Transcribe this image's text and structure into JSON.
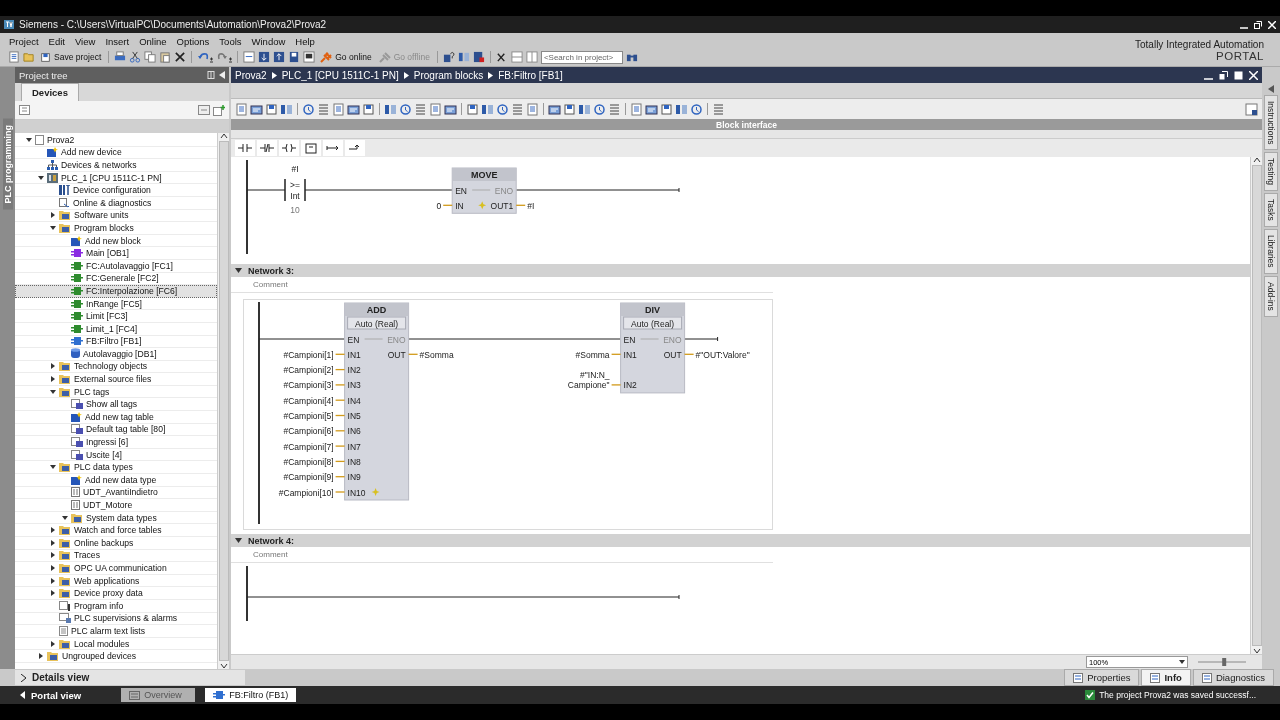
{
  "window": {
    "title": "Siemens  -  C:\\Users\\VirtualPC\\Documents\\Automation\\Prova2\\Prova2"
  },
  "menu": [
    "Project",
    "Edit",
    "View",
    "Insert",
    "Online",
    "Options",
    "Tools",
    "Window",
    "Help"
  ],
  "toolbar": {
    "save": "Save project",
    "go_online": "Go online",
    "go_offline": "Go offline",
    "search": {
      "placeholder": "<Search in project>"
    }
  },
  "brand": {
    "line1": "Totally Integrated Automation",
    "line2": "PORTAL"
  },
  "side_tab": "PLC programming",
  "project_tree": {
    "title": "Project tree",
    "tab": "Devices",
    "details": "Details view",
    "items": [
      {
        "label": "Prova2",
        "kind": "root",
        "expanded": true,
        "selected": false,
        "children": [
          {
            "label": "Add new device",
            "kind": "add",
            "selected": false
          },
          {
            "label": "Devices & networks",
            "kind": "network",
            "selected": false
          },
          {
            "label": "PLC_1 [CPU 1511C-1 PN]",
            "kind": "plc",
            "expanded": true,
            "selected": false,
            "children": [
              {
                "label": "Device configuration",
                "kind": "config",
                "selected": false
              },
              {
                "label": "Online & diagnostics",
                "kind": "diag",
                "selected": false
              },
              {
                "label": "Software units",
                "kind": "folder",
                "expanded": false,
                "selected": false
              },
              {
                "label": "Program blocks",
                "kind": "folder",
                "expanded": true,
                "selected": false,
                "children": [
                  {
                    "label": "Add new block",
                    "kind": "add",
                    "selected": false
                  },
                  {
                    "label": "Main [OB1]",
                    "kind": "ob",
                    "selected": false
                  },
                  {
                    "label": "FC:Autolavaggio [FC1]",
                    "kind": "fc",
                    "selected": false
                  },
                  {
                    "label": "FC:Generale [FC2]",
                    "kind": "fc",
                    "selected": false
                  },
                  {
                    "label": "FC:Interpolazione [FC6]",
                    "kind": "fc",
                    "selected": true
                  },
                  {
                    "label": "InRange [FC5]",
                    "kind": "fc",
                    "selected": false
                  },
                  {
                    "label": "Limit [FC3]",
                    "kind": "fc",
                    "selected": false
                  },
                  {
                    "label": "Limit_1 [FC4]",
                    "kind": "fc",
                    "selected": false
                  },
                  {
                    "label": "FB:Filtro [FB1]",
                    "kind": "fb",
                    "selected": false
                  },
                  {
                    "label": "Autolavaggio [DB1]",
                    "kind": "db",
                    "selected": false
                  }
                ]
              },
              {
                "label": "Technology objects",
                "kind": "folder",
                "expanded": false,
                "selected": false
              },
              {
                "label": "External source files",
                "kind": "folder",
                "expanded": false,
                "selected": false
              },
              {
                "label": "PLC tags",
                "kind": "folder",
                "expanded": true,
                "selected": false,
                "children": [
                  {
                    "label": "Show all tags",
                    "kind": "tags",
                    "selected": false
                  },
                  {
                    "label": "Add new tag table",
                    "kind": "add",
                    "selected": false
                  },
                  {
                    "label": "Default tag table [80]",
                    "kind": "tags",
                    "selected": false
                  },
                  {
                    "label": "Ingressi [6]",
                    "kind": "tags",
                    "selected": false
                  },
                  {
                    "label": "Uscite [4]",
                    "kind": "tags",
                    "selected": false
                  }
                ]
              },
              {
                "label": "PLC data types",
                "kind": "folder",
                "expanded": true,
                "selected": false,
                "children": [
                  {
                    "label": "Add new data type",
                    "kind": "add",
                    "selected": false
                  },
                  {
                    "label": "UDT_AvantiIndietro",
                    "kind": "udt",
                    "selected": false
                  },
                  {
                    "label": "UDT_Motore",
                    "kind": "udt",
                    "selected": false
                  },
                  {
                    "label": "System data types",
                    "kind": "folder",
                    "expanded": true,
                    "selected": false
                  }
                ]
              },
              {
                "label": "Watch and force tables",
                "kind": "folder",
                "expanded": false,
                "selected": false
              },
              {
                "label": "Online backups",
                "kind": "folder",
                "expanded": false,
                "selected": false
              },
              {
                "label": "Traces",
                "kind": "folder",
                "expanded": false,
                "selected": false
              },
              {
                "label": "OPC UA communication",
                "kind": "folder",
                "expanded": false,
                "selected": false
              },
              {
                "label": "Web applications",
                "kind": "folder",
                "expanded": false,
                "selected": false
              },
              {
                "label": "Device proxy data",
                "kind": "folder",
                "expanded": false,
                "selected": false
              },
              {
                "label": "Program info",
                "kind": "info",
                "selected": false
              },
              {
                "label": "PLC supervisions & alarms",
                "kind": "alarm",
                "selected": false
              },
              {
                "label": "PLC alarm text lists",
                "kind": "text",
                "selected": false
              },
              {
                "label": "Local modules",
                "kind": "folder",
                "expanded": false,
                "selected": false
              }
            ]
          },
          {
            "label": "Ungrouped devices",
            "kind": "folder",
            "expanded": false,
            "selected": false
          }
        ]
      }
    ]
  },
  "breadcrumb": [
    "Prova2",
    "PLC_1 [CPU 1511C-1 PN]",
    "Program blocks",
    "FB:Filtro [FB1]"
  ],
  "block_interface": "Block interface",
  "networks": [
    {
      "elements": [
        {
          "kind": "compare",
          "operand": "#I",
          "op": ">=",
          "type": "Int",
          "value": "10"
        },
        {
          "kind": "box",
          "name": "MOVE",
          "en": "EN",
          "eno": "ENO",
          "add_pin": true,
          "inputs": [
            {
              "pin": "IN",
              "operand": "0"
            }
          ],
          "outputs": [
            {
              "pin": "OUT1",
              "operand": "#I"
            }
          ]
        }
      ]
    },
    {
      "title": "Network 3:",
      "comment": "Comment",
      "elements": [
        {
          "kind": "box",
          "name": "ADD",
          "type": "Auto (Real)",
          "en": "EN",
          "eno": "ENO",
          "add_pin": true,
          "inputs": [
            {
              "pin": "IN1",
              "operand": "#Campioni[1]"
            },
            {
              "pin": "IN2",
              "operand": "#Campioni[2]"
            },
            {
              "pin": "IN3",
              "operand": "#Campioni[3]"
            },
            {
              "pin": "IN4",
              "operand": "#Campioni[4]"
            },
            {
              "pin": "IN5",
              "operand": "#Campioni[5]"
            },
            {
              "pin": "IN6",
              "operand": "#Campioni[6]"
            },
            {
              "pin": "IN7",
              "operand": "#Campioni[7]"
            },
            {
              "pin": "IN8",
              "operand": "#Campioni[8]"
            },
            {
              "pin": "IN9",
              "operand": "#Campioni[9]"
            },
            {
              "pin": "IN10",
              "operand": "#Campioni[10]"
            }
          ],
          "outputs": [
            {
              "pin": "OUT",
              "operand": "#Somma"
            }
          ]
        },
        {
          "kind": "box",
          "name": "DIV",
          "type": "Auto (Real)",
          "en": "EN",
          "eno": "ENO",
          "inputs": [
            {
              "pin": "IN1",
              "operand": "#Somma"
            },
            {
              "pin": "IN2",
              "operand": "#\"IN:N_\nCampione\""
            }
          ],
          "outputs": [
            {
              "pin": "OUT",
              "operand": "#\"OUT:Valore\""
            }
          ]
        }
      ]
    },
    {
      "title": "Network 4:",
      "comment": "Comment"
    }
  ],
  "zoom": "100%",
  "zoom_slider": {
    "level": 0.55
  },
  "right_tabs": [
    "Instructions",
    "Testing",
    "Tasks",
    "Libraries",
    "Add-ins"
  ],
  "inspector_tabs": [
    {
      "label": "Properties",
      "selected": false
    },
    {
      "label": "Info",
      "selected": true
    },
    {
      "label": "Diagnostics",
      "selected": false
    }
  ],
  "taskbar": {
    "portal_view": "Portal view",
    "items": [
      {
        "label": "Overview",
        "selected": false
      },
      {
        "label": "FB:Filtro (FB1)",
        "selected": true
      }
    ],
    "status": "The project Prova2 was saved successf..."
  }
}
